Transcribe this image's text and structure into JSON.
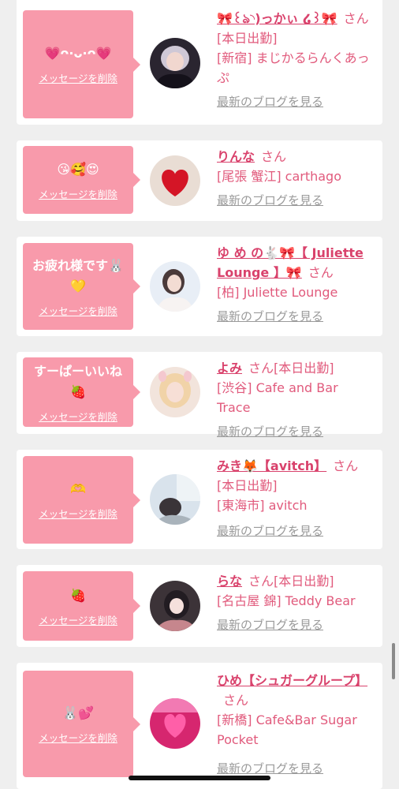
{
  "messages": [
    {
      "message": "💗ᴖ·ᴗ·ᴖ💗",
      "delete_label": "メッセージを削除",
      "name": "🎀꒰ঌ◝)っかぃ ໒꒱🎀",
      "san": "さん",
      "status": "[本日出勤]",
      "shop": "[新宿] まじかるらんくあっぷ",
      "blog_label": "最新のブログを見る",
      "avatar_icon": "cast-photo-avatar"
    },
    {
      "message": "😘🥰😍",
      "delete_label": "メッセージを削除",
      "name": "りんな",
      "san": "さん",
      "status": "",
      "shop": "[尾張 蟹江] carthago",
      "blog_label": "最新のブログを見る",
      "avatar_icon": "heart-avatar"
    },
    {
      "message": "お疲れ様です🐰💛",
      "delete_label": "メッセージを削除",
      "name": "ゆ め の🐇🎀【 Juliette Lounge 】🎀",
      "san": "さん",
      "status": "",
      "shop": "[柏] Juliette Lounge",
      "blog_label": "最新のブログを見る",
      "avatar_icon": "cast-photo-avatar"
    },
    {
      "message": "すーぱーいいね🍓",
      "delete_label": "メッセージを削除",
      "name": "よみ",
      "san": "さん",
      "status": "[本日出勤]",
      "shop": "[渋谷] Cafe and Bar Trace",
      "blog_label": "最新のブログを見る",
      "avatar_icon": "cast-photo-avatar"
    },
    {
      "message": "🫶",
      "delete_label": "メッセージを削除",
      "name": "みき🦊【avitch】",
      "san": "さん",
      "status": "[本日出勤]",
      "shop": "[東海市] avitch",
      "blog_label": "最新のブログを見る",
      "avatar_icon": "cast-photo-avatar"
    },
    {
      "message": "🍓",
      "delete_label": "メッセージを削除",
      "name": "らな",
      "san": "さん",
      "status": "[本日出勤]",
      "shop": "[名古屋 錦] Teddy Bear",
      "blog_label": "最新のブログを見る",
      "avatar_icon": "cast-photo-avatar"
    },
    {
      "message": "🐰💕",
      "delete_label": "メッセージを削除",
      "name": "ひめ【シュガーグループ】",
      "san": "さん",
      "status": "",
      "shop": "[新橋] Cafe&Bar Sugar Pocket",
      "blog_label": "最新のブログを見る",
      "avatar_icon": "heart-avatar"
    }
  ],
  "colors": {
    "background": "#efefef",
    "card": "#ffffff",
    "bubble": "#f89aab",
    "name": "#d9426c",
    "text": "#e15a7c",
    "blog_link": "#9a9a9a"
  }
}
